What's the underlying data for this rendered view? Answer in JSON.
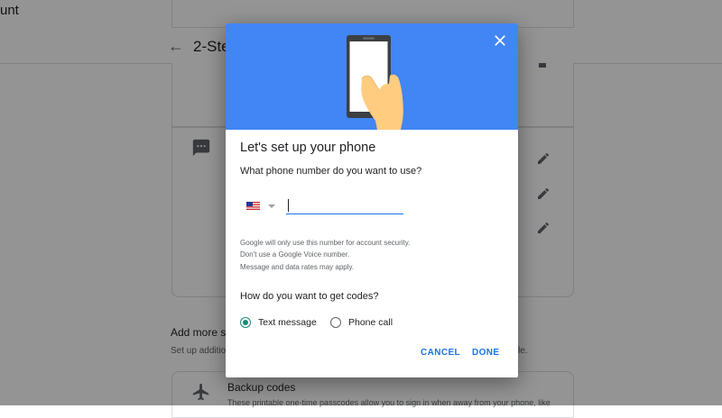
{
  "background": {
    "account_text": "unt",
    "page_title": "2-Ste",
    "section_title": "Add more se",
    "section_desc": "Set up additio",
    "section_desc_end": "le.",
    "backup_title": "Backup codes",
    "backup_desc": "These printable one-time passcodes allow you to sign in when away from your phone, like"
  },
  "dialog": {
    "title": "Let's set up your phone",
    "question": "What phone number do you want to use?",
    "phone_value": "",
    "note_lines": [
      "Google will only use this number for account security.",
      "Don't use a Google Voice number.",
      "Message and data rates may apply."
    ],
    "codes_question": "How do you want to get codes?",
    "options": [
      {
        "label": "Text message",
        "selected": true
      },
      {
        "label": "Phone call",
        "selected": false
      }
    ],
    "cancel_label": "CANCEL",
    "done_label": "DONE"
  },
  "colors": {
    "hero": "#4285f4",
    "accent": "#1a73e8",
    "radio_selected": "#1a8a7a",
    "scrim": "rgba(0,0,0,0.42)"
  }
}
